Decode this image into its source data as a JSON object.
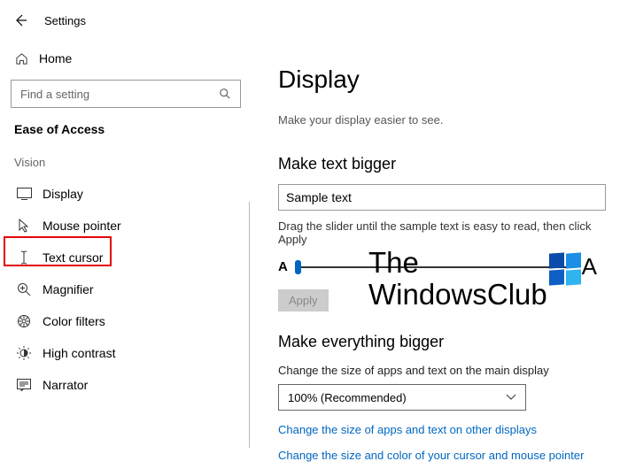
{
  "app_title": "Settings",
  "sidebar": {
    "home_label": "Home",
    "search_placeholder": "Find a setting",
    "section_title": "Ease of Access",
    "group_label": "Vision",
    "items": [
      {
        "label": "Display"
      },
      {
        "label": "Mouse pointer"
      },
      {
        "label": "Text cursor"
      },
      {
        "label": "Magnifier"
      },
      {
        "label": "Color filters"
      },
      {
        "label": "High contrast"
      },
      {
        "label": "Narrator"
      }
    ]
  },
  "main": {
    "title": "Display",
    "intro": "Make your display easier to see.",
    "text_bigger_heading": "Make text bigger",
    "sample_text": "Sample text",
    "slider_hint": "Drag the slider until the sample text is easy to read, then click Apply",
    "apply_label": "Apply",
    "everything_heading": "Make everything bigger",
    "everything_desc": "Change the size of apps and text on the main display",
    "scale_value": "100% (Recommended)",
    "link_other_displays": "Change the size of apps and text on other displays",
    "link_cursor": "Change the size and color of your cursor and mouse pointer"
  },
  "watermark": {
    "line1": "The",
    "line2": "WindowsClub"
  }
}
